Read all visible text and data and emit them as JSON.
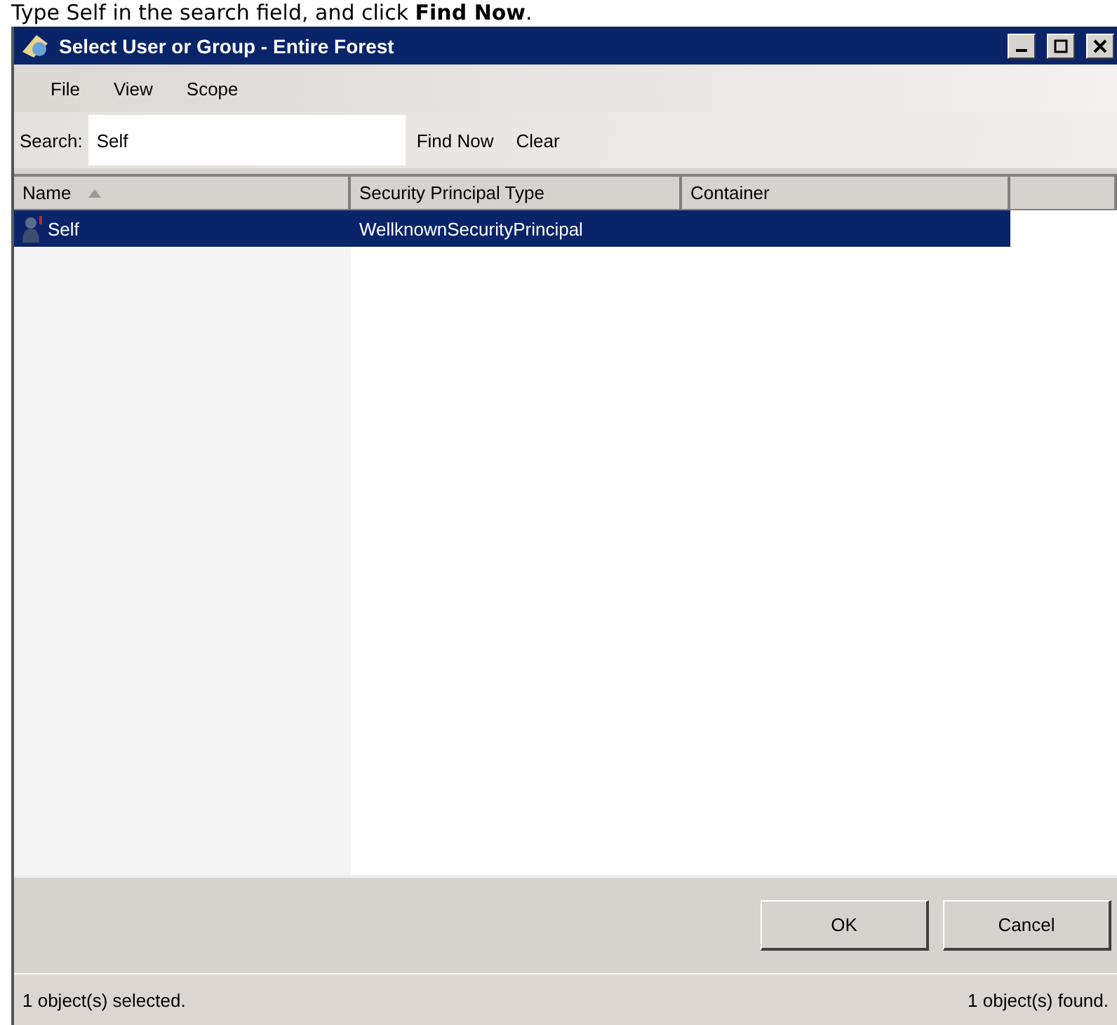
{
  "caption": "Type Self in the search field, and click **Find Now**.",
  "window": {
    "title": "Select User or Group - Entire Forest"
  },
  "menu": [
    "File",
    "View",
    "Scope"
  ],
  "search": {
    "label": "Search:",
    "value": "Self",
    "buttons": [
      "Find Now",
      "Clear"
    ]
  },
  "table": {
    "columns": [
      {
        "label": "Name",
        "sorted": true
      },
      {
        "label": "Security Principal Type",
        "sorted": false
      },
      {
        "label": "Container",
        "sorted": false
      }
    ],
    "rows": [
      {
        "cells": [
          "Self",
          "WellknownSecurityPrincipal",
          ""
        ],
        "selected": true
      }
    ]
  },
  "buttons": [
    "OK",
    "Cancel"
  ],
  "status_bar": {
    "left": "1 object(s) selected.",
    "right": "1 object(s) found."
  }
}
